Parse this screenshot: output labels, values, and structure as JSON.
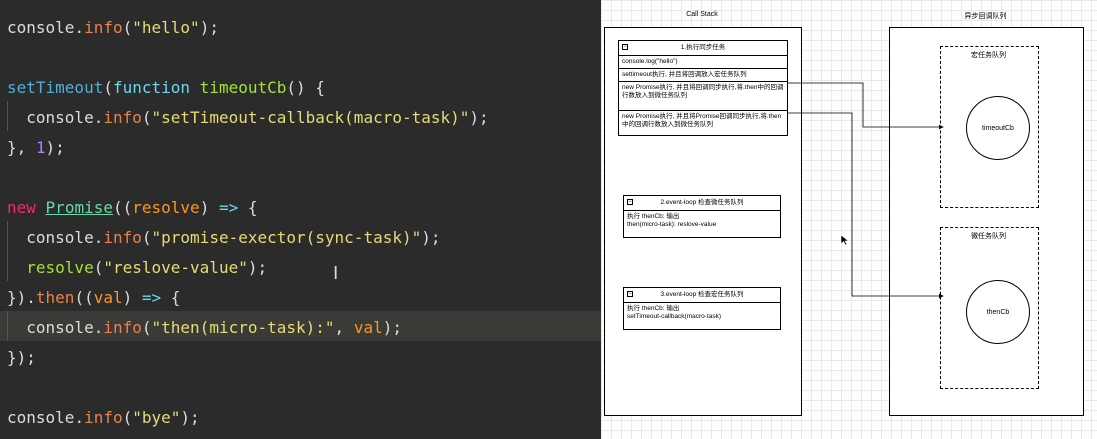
{
  "editor": {
    "lines": [
      {
        "tokens": [
          [
            "console",
            "tok-id"
          ],
          [
            ".",
            "tok-punc"
          ],
          [
            "info",
            "tok-method"
          ],
          [
            "(",
            "tok-punc"
          ],
          [
            "\"hello\"",
            "tok-str"
          ],
          [
            ");",
            "tok-punc"
          ]
        ]
      },
      {
        "tokens": []
      },
      {
        "tokens": [
          [
            "setTimeout",
            "tok-fn"
          ],
          [
            "(",
            "tok-punc"
          ],
          [
            "function",
            "tok-kw"
          ],
          [
            " ",
            "tok-punc"
          ],
          [
            "timeoutCb",
            "tok-name"
          ],
          [
            "() {",
            "tok-punc"
          ]
        ]
      },
      {
        "tokens": [
          [
            "  console",
            "tok-id"
          ],
          [
            ".",
            "tok-punc"
          ],
          [
            "info",
            "tok-method"
          ],
          [
            "(",
            "tok-punc"
          ],
          [
            "\"setTimeout-callback(macro-task)\"",
            "tok-str"
          ],
          [
            ");",
            "tok-punc"
          ]
        ]
      },
      {
        "tokens": [
          [
            "}, ",
            "tok-punc"
          ],
          [
            "1",
            "tok-num"
          ],
          [
            ");",
            "tok-punc"
          ]
        ]
      },
      {
        "tokens": []
      },
      {
        "tokens": [
          [
            "new",
            "tok-new"
          ],
          [
            " ",
            "tok-punc"
          ],
          [
            "Promise",
            "tok-class"
          ],
          [
            "((",
            "tok-punc"
          ],
          [
            "resolve",
            "tok-param"
          ],
          [
            ") ",
            "tok-punc"
          ],
          [
            "=>",
            "tok-arrow"
          ],
          [
            " {",
            "tok-punc"
          ]
        ]
      },
      {
        "tokens": [
          [
            "  console",
            "tok-id"
          ],
          [
            ".",
            "tok-punc"
          ],
          [
            "info",
            "tok-method"
          ],
          [
            "(",
            "tok-punc"
          ],
          [
            "\"promise-exector(sync-task)\"",
            "tok-str"
          ],
          [
            ");",
            "tok-punc"
          ]
        ]
      },
      {
        "tokens": [
          [
            "  ",
            "tok-punc"
          ],
          [
            "resolve",
            "tok-call"
          ],
          [
            "(",
            "tok-punc"
          ],
          [
            "\"reslove-value\"",
            "tok-str"
          ],
          [
            ");",
            "tok-punc"
          ]
        ]
      },
      {
        "tokens": [
          [
            "})",
            "tok-punc"
          ],
          [
            ".",
            "tok-punc"
          ],
          [
            "then",
            "tok-method"
          ],
          [
            "((",
            "tok-punc"
          ],
          [
            "val",
            "tok-param"
          ],
          [
            ") ",
            "tok-punc"
          ],
          [
            "=>",
            "tok-arrow"
          ],
          [
            " {",
            "tok-punc"
          ]
        ]
      },
      {
        "tokens": [
          [
            "  console",
            "tok-id"
          ],
          [
            ".",
            "tok-punc"
          ],
          [
            "info",
            "tok-method"
          ],
          [
            "(",
            "tok-punc"
          ],
          [
            "\"then(micro-task):\"",
            "tok-str"
          ],
          [
            ", ",
            "tok-punc"
          ],
          [
            "val",
            "tok-param"
          ],
          [
            ");",
            "tok-punc"
          ]
        ]
      },
      {
        "tokens": [
          [
            "});",
            "tok-punc"
          ]
        ]
      },
      {
        "tokens": []
      },
      {
        "tokens": [
          [
            "console",
            "tok-id"
          ],
          [
            ".",
            "tok-punc"
          ],
          [
            "info",
            "tok-method"
          ],
          [
            "(",
            "tok-punc"
          ],
          [
            "\"bye\"",
            "tok-str"
          ],
          [
            ");",
            "tok-punc"
          ]
        ]
      }
    ]
  },
  "diagram": {
    "call_stack_title": "Call Stack",
    "async_queue_title": "异步回调队列",
    "table1": {
      "header": "1.执行同步任务",
      "rows": [
        "console.log(\"hello\")",
        "settimeout执行, 并且将回调放入宏任务队列",
        "new Promise执行, 并且将回调同步执行,将.then中的回调行数放入到微任务队列",
        "new Promise执行, 并且将Promise回调同步执行,将.then中的回调行数放入到微任务队列"
      ]
    },
    "table2": {
      "header": "2.event-loop 检查微任务队列",
      "rows": [
        "执行 thenCb: 输出\nthen(micro-task): reslove-value"
      ]
    },
    "table3": {
      "header": "3.event-loop 检查宏任务队列",
      "rows": [
        "执行 thenCb: 输出\nsetTimeout-callback(macro-task)"
      ]
    },
    "macro_queue_title": "宏任务队列",
    "micro_queue_title": "微任务队列",
    "macro_item": "timeoutCb",
    "micro_item": "thenCb",
    "collapse_glyph": "−"
  }
}
